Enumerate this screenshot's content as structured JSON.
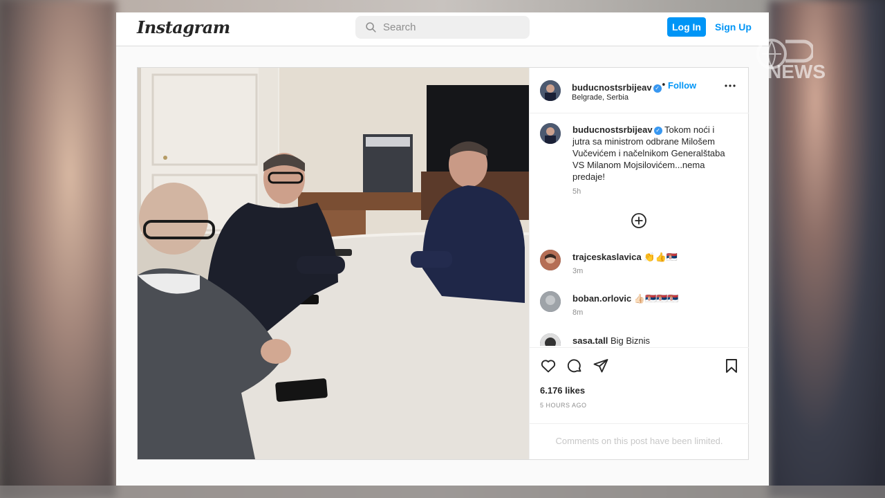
{
  "header": {
    "logo": "Instagram",
    "search_placeholder": "Search",
    "login_label": "Log In",
    "signup_label": "Sign Up"
  },
  "post": {
    "username": "buducnostsrbijeav",
    "verified": true,
    "follow_label": "Follow",
    "location": "Belgrade, Serbia",
    "caption": "Tokom noći i jutra sa ministrom odbrane Milošem Vučevićem i načelnikom Generalštaba VS Milanom Mojsilovićem...nema predaje!",
    "caption_time": "5h",
    "likes": "6.176 likes",
    "posted_ago": "5 HOURS AGO",
    "comments_limited": "Comments on this post have been limited."
  },
  "comments": [
    {
      "username": "trajceskaslavica",
      "text": "👏👍🇷🇸",
      "time": "3m"
    },
    {
      "username": "boban.orlovic",
      "text": "👍🏻🇷🇸🇷🇸🇷🇸",
      "time": "8m"
    },
    {
      "username": "sasa.tall",
      "text": "Big Biznis",
      "time": ""
    }
  ],
  "icons": {
    "search": "search-icon",
    "more": "more-options-icon",
    "load_more": "plus-circle-icon",
    "like": "heart-icon",
    "comment": "comment-bubble-icon",
    "share": "paper-plane-icon",
    "save": "bookmark-icon"
  },
  "colors": {
    "accent": "#0095f6",
    "text": "#262626",
    "muted": "#8e8e8e",
    "verified": "#3897f0"
  },
  "watermark": "NEWS"
}
